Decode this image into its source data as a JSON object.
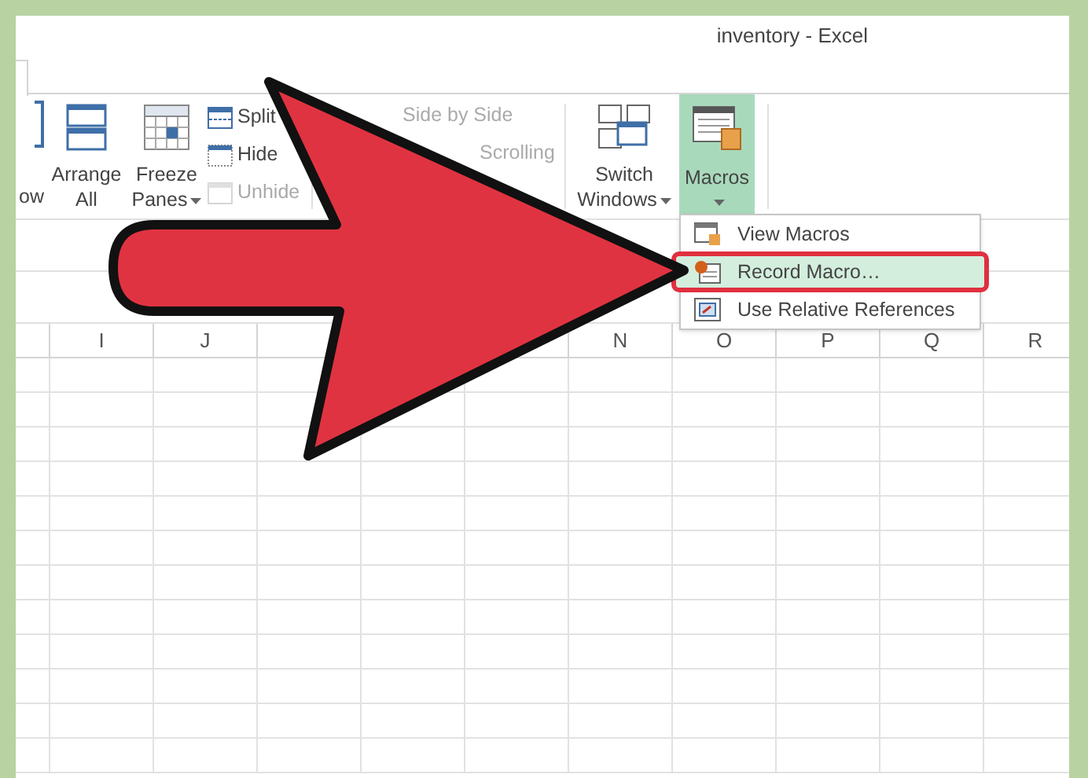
{
  "window": {
    "title": "inventory - Excel"
  },
  "ribbon": {
    "cut_button": {
      "label": "ow"
    },
    "large_buttons": [
      {
        "label": "Arrange All",
        "dropdown": false,
        "kind": "arrange"
      },
      {
        "label": "Freeze Panes",
        "dropdown": true,
        "kind": "freeze"
      }
    ],
    "small_buttons": [
      {
        "label": "Split",
        "disabled": false,
        "kind": "split"
      },
      {
        "label": "Hide",
        "disabled": false,
        "kind": "hide"
      },
      {
        "label": "Unhide",
        "disabled": true,
        "kind": "unhide"
      }
    ],
    "compare_buttons": [
      {
        "label": "Side by Side",
        "disabled": true
      },
      {
        "label": "Scrolling",
        "disabled": true
      }
    ],
    "switch_windows": {
      "label": "Switch Windows",
      "dropdown": true
    },
    "macros": {
      "label": "Macros",
      "selected": true
    }
  },
  "macros_menu": [
    {
      "label": "View Macros",
      "highlighted": false,
      "kind": "view"
    },
    {
      "label": "Record Macro…",
      "highlighted": true,
      "kind": "record"
    },
    {
      "label": "Use Relative References",
      "highlighted": false,
      "kind": "relative"
    }
  ],
  "sheet": {
    "columns_left": [
      "I",
      "J"
    ],
    "columns_right": [
      "N",
      "O",
      "P",
      "Q",
      "R"
    ]
  }
}
